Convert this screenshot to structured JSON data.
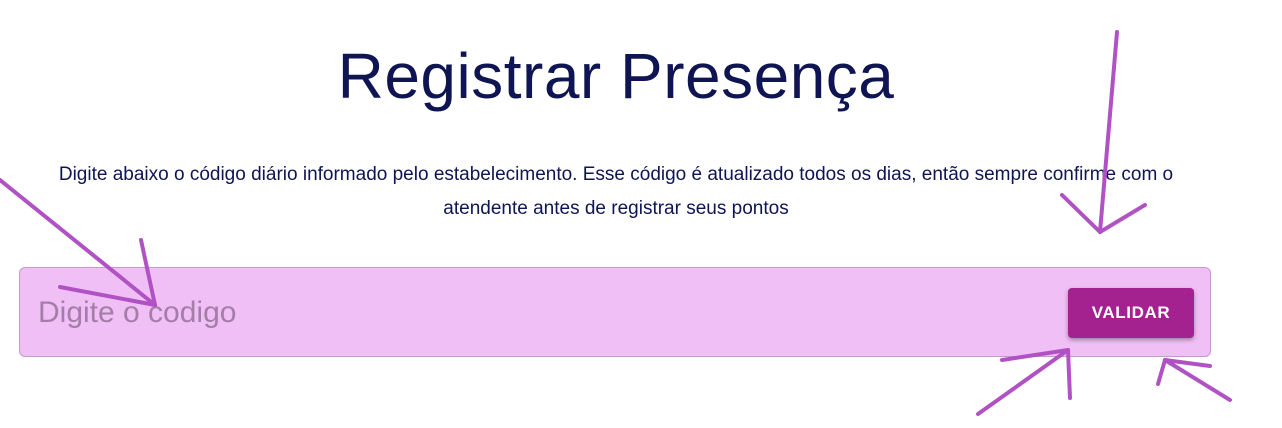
{
  "page": {
    "title": "Registrar Presença",
    "description": "Digite abaixo o código diário informado pelo estabelecimento. Esse código é atualizado todos os dias, então sempre confirme com o atendente antes de registrar seus pontos"
  },
  "code_form": {
    "input_value": "",
    "input_placeholder": "Digite o codigo",
    "validate_label": "VALIDAR"
  },
  "colors": {
    "title_text": "#0f1452",
    "input_background": "#f0bff5",
    "button_background": "#a3228f",
    "annotation_stroke": "#b052c4"
  },
  "annotations": {
    "icon": "hand-drawn-arrow-icon"
  }
}
